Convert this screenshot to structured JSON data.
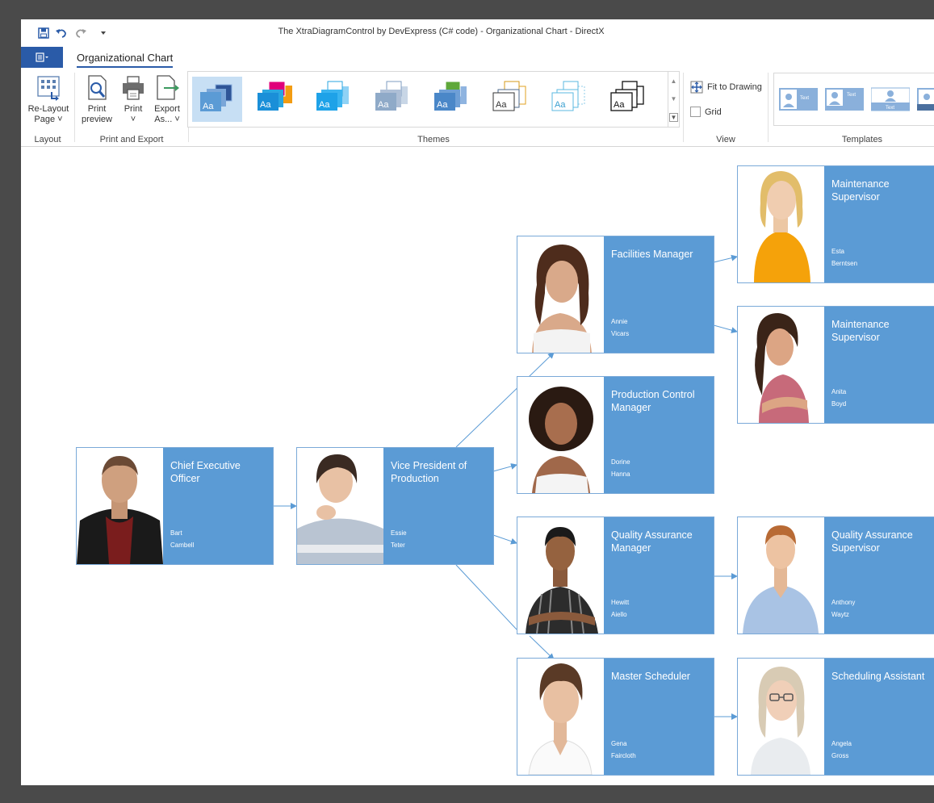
{
  "window": {
    "title": "The XtraDiagramControl by DevExpress (C# code) - Organizational Chart - DirectX"
  },
  "ribbon": {
    "tab": "Organizational Chart",
    "groups": {
      "layout": {
        "label": "Layout",
        "relayout_line1": "Re-Layout",
        "relayout_line2": "Page"
      },
      "print": {
        "label": "Print and Export",
        "preview_line1": "Print",
        "preview_line2": "preview",
        "print": "Print",
        "export_line1": "Export",
        "export_line2": "As..."
      },
      "themes": {
        "label": "Themes",
        "sample_text": "Aa"
      },
      "view": {
        "label": "View",
        "fit": "Fit to Drawing",
        "grid": "Grid"
      },
      "templates": {
        "label": "Templates",
        "sample_text": "Text"
      }
    }
  },
  "org_chart": {
    "accent": "#5b9bd5",
    "nodes": [
      {
        "role": "Chief Executive Officer",
        "first": "Bart",
        "last": "Cambell"
      },
      {
        "role": "Vice President of Production",
        "first": "Essie",
        "last": "Teter"
      },
      {
        "role": "Facilities Manager",
        "first": "Annie",
        "last": "Vicars"
      },
      {
        "role": "Production Control Manager",
        "first": "Dorine",
        "last": "Hanna"
      },
      {
        "role": "Quality Assurance Manager",
        "first": "Hewitt",
        "last": "Aiello"
      },
      {
        "role": "Master Scheduler",
        "first": "Gena",
        "last": "Faircloth"
      },
      {
        "role": "Maintenance Supervisor",
        "first": "Esta",
        "last": "Berntsen"
      },
      {
        "role": "Maintenance Supervisor",
        "first": "Anita",
        "last": "Boyd"
      },
      {
        "role": "Quality Assurance Supervisor",
        "first": "Anthony",
        "last": "Waytz"
      },
      {
        "role": "Scheduling Assistant",
        "first": "Angela",
        "last": "Gross"
      }
    ]
  }
}
